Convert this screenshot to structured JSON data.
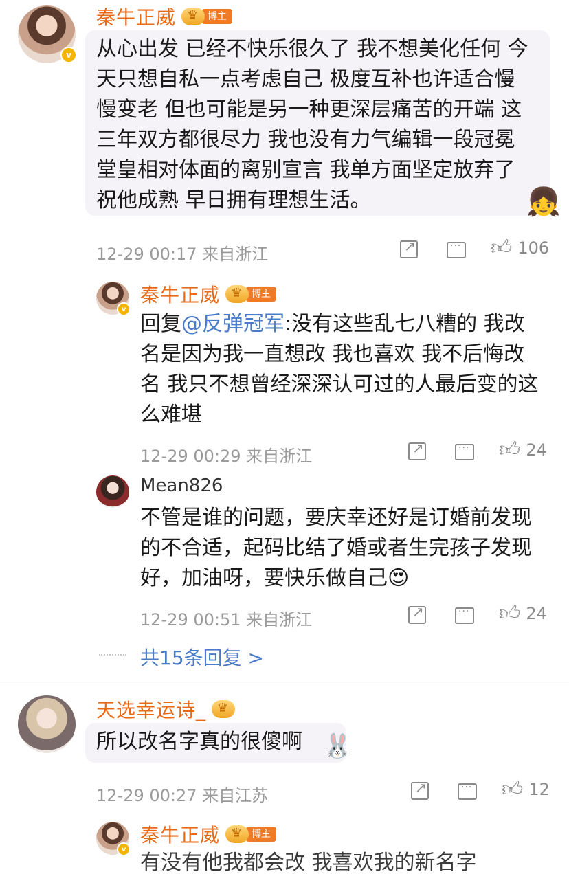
{
  "c1": {
    "username": "秦牛正威",
    "tag": "博主",
    "text_lines": [
      "从心出发 已经不快乐很久了 我不想美化任何 今",
      "天只想自私一点考虑自己 极度互补也许适合慢",
      "慢变老 但也可能是另一种更深层痛苦的开端 这",
      "三年双方都很尽力 我也没有力气编辑一段冠冕",
      "堂皇相对体面的离别宣言 我单方面坚定放弃了",
      "祝他成熟 早日拥有理想生活。"
    ],
    "meta": "12-29 00:17 来自浙江",
    "likes": "106"
  },
  "r1": {
    "username": "秦牛正威",
    "tag": "博主",
    "reply_prefix": "回复",
    "at_user": "@反弹冠军",
    "text_first": ":没有这些乱七八糟的 我改",
    "text_lines": [
      "名是因为我一直想改 我也喜欢 我不后悔改",
      "名 我只不想曾经深深认可过的人最后变的这",
      "么难堪"
    ],
    "meta": "12-29 00:29 来自浙江",
    "likes": "24"
  },
  "r2": {
    "username": "Mean826",
    "text_lines": [
      "不管是谁的问题，要庆幸还好是订婚前发现",
      "的不合适，起码比结了婚或者生完孩子发现",
      "好，加油呀，要快乐做自己"
    ],
    "emoji": "😍",
    "meta": "12-29 00:51 来自浙江",
    "likes": "24"
  },
  "more_replies": "共15条回复 >",
  "c2": {
    "username": "天选幸运诗_",
    "text": "所以改名字真的很傻啊",
    "meta": "12-29 00:27 来自江苏",
    "likes": "12"
  },
  "r3": {
    "username": "秦牛正威",
    "tag": "博主",
    "text_partial": "有没有他我都会改 我喜欢我的新名字"
  },
  "icons": {
    "share": "share-icon",
    "comment": "comment-icon",
    "like": "thumbs-up-icon",
    "verified": "verified-badge-icon",
    "crown": "crown-icon"
  },
  "colors": {
    "username": "#e86a17",
    "link": "#4a7bc8",
    "meta": "#9a9a9a",
    "bubble": "#f5f2f8"
  }
}
